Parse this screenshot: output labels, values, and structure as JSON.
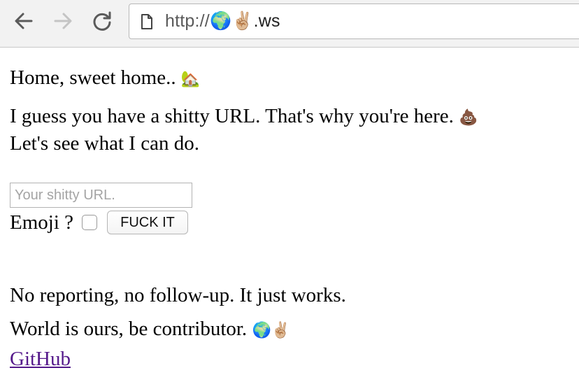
{
  "browser": {
    "url_scheme": "http://",
    "url_emoji": "🌍✌🏼",
    "url_suffix": ".ws",
    "icons": {
      "back": "arrow-left-icon",
      "forward": "arrow-right-icon",
      "reload": "reload-icon",
      "page": "page-icon"
    }
  },
  "page": {
    "greeting": "Home, sweet home..",
    "greeting_emoji": "🏡",
    "intro_line1": "I guess you have a shitty URL. That's why you're here.",
    "intro_emoji": "💩",
    "intro_line2": "Let's see what I can do.",
    "form": {
      "url_placeholder": "Your shitty URL.",
      "url_value": "",
      "emoji_label": "Emoji ?",
      "emoji_checked": false,
      "submit_label": "FUCK IT"
    },
    "tagline1": "No reporting, no follow-up. It just works.",
    "tagline2": "World is ours, be contributor.",
    "tagline2_emoji": "🌍✌🏼",
    "github_link": "GitHub"
  },
  "colors": {
    "toolbar_bg": "#f2f2f2",
    "link_visited": "#551a8b"
  }
}
